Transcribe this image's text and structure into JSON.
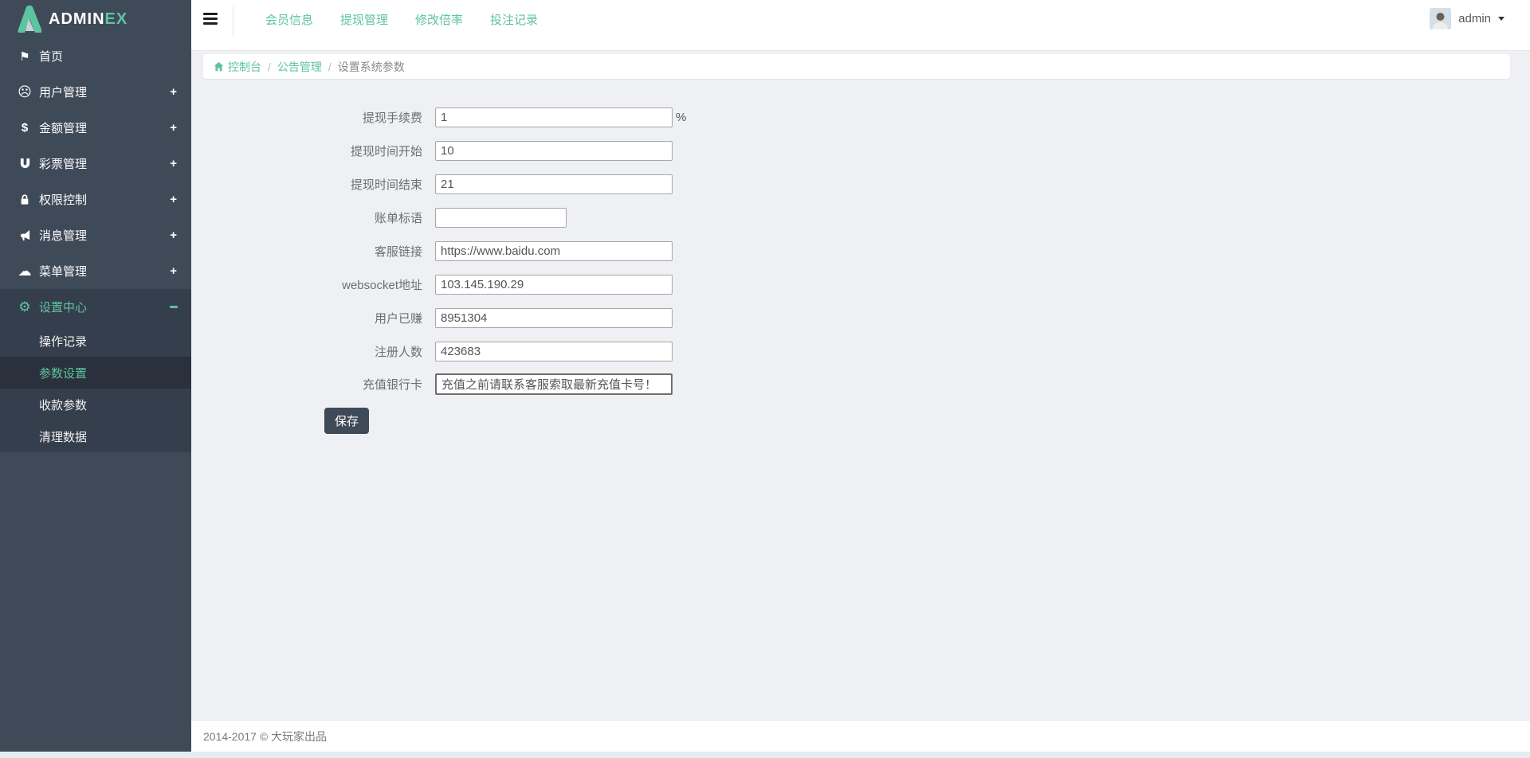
{
  "logo": {
    "text_primary": "ADMIN",
    "text_accent": "EX"
  },
  "icons_glyphs": {
    "plus": "+",
    "flag": "⚑",
    "frown": "☹",
    "dollar": "$",
    "cloud": "☁",
    "gear": "⚙"
  },
  "sidebar": {
    "items": [
      {
        "label": "首页",
        "icon": "flag-icon"
      },
      {
        "label": "用户管理",
        "icon": "frown-face-icon",
        "expand": "+"
      },
      {
        "label": "金额管理",
        "icon": "dollar-icon",
        "expand": "+"
      },
      {
        "label": "彩票管理",
        "icon": "magnet-icon",
        "expand": "+"
      },
      {
        "label": "权限控制",
        "icon": "lock-icon",
        "expand": "+"
      },
      {
        "label": "消息管理",
        "icon": "bullhorn-icon",
        "expand": "+"
      },
      {
        "label": "菜单管理",
        "icon": "cloud-icon",
        "expand": "+"
      },
      {
        "label": "设置中心",
        "icon": "gear-icon",
        "expand": "collapse",
        "active": true,
        "children": [
          {
            "label": "操作记录"
          },
          {
            "label": "参数设置",
            "active": true
          },
          {
            "label": "收款参数"
          },
          {
            "label": "清理数据"
          }
        ]
      }
    ]
  },
  "topnav": {
    "links": [
      {
        "label": "会员信息"
      },
      {
        "label": "提现管理"
      },
      {
        "label": "修改倍率"
      },
      {
        "label": "投注记录"
      }
    ],
    "user": {
      "name": "admin"
    }
  },
  "breadcrumb": {
    "separator": "/",
    "items": [
      {
        "label": "控制台"
      },
      {
        "label": "公告管理"
      },
      {
        "label": "设置系统参数"
      }
    ]
  },
  "form": {
    "fields": [
      {
        "label": "提现手续费",
        "value": "1",
        "suffix": "%"
      },
      {
        "label": "提现时间开始",
        "value": "10"
      },
      {
        "label": "提现时间结束",
        "value": "21"
      },
      {
        "label": "账单标语",
        "value": ""
      },
      {
        "label": "客服链接",
        "value": "https://www.baidu.com"
      },
      {
        "label": "websocket地址",
        "value": "103.145.190.29"
      },
      {
        "label": "用户已赚",
        "value": "8951304"
      },
      {
        "label": "注册人数",
        "value": "423683"
      },
      {
        "label": "充值银行卡",
        "value": "充值之前请联系客服索取最新充值卡号！"
      }
    ],
    "save_label": "保存"
  },
  "footer": {
    "copyright": "2014-2017 © 大玩家出品"
  },
  "colors": {
    "accent_green": "#5ec3a1",
    "sidebar_bg": "#3f4a59",
    "sidebar_expanded_bg": "#353e4c",
    "sidebar_active_bg": "#2a313d",
    "content_bg": "#eef0f4"
  }
}
